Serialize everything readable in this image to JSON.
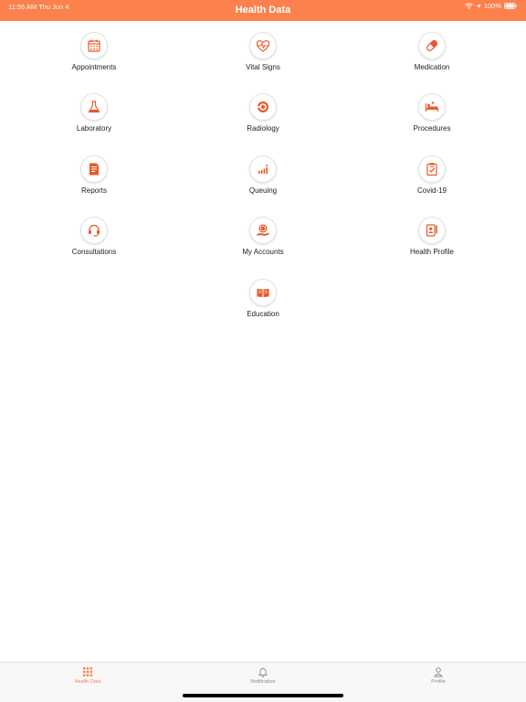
{
  "status": {
    "time": "11:55 AM   Thu Jun 4",
    "battery": "100%"
  },
  "header": {
    "title": "Health Data"
  },
  "colors": {
    "accent": "#fc814c",
    "icon": "#e8592a",
    "tab_inactive": "#8a8a8a"
  },
  "tiles": [
    {
      "label": "Appointments",
      "icon": "calendar-icon"
    },
    {
      "label": "Vital Signs",
      "icon": "heart-pulse-icon"
    },
    {
      "label": "Medication",
      "icon": "pill-icon"
    },
    {
      "label": "Laboratory",
      "icon": "flask-icon"
    },
    {
      "label": "Radiology",
      "icon": "radiology-icon"
    },
    {
      "label": "Procedures",
      "icon": "hospital-bed-icon"
    },
    {
      "label": "Reports",
      "icon": "report-document-icon"
    },
    {
      "label": "Queuing",
      "icon": "queue-icon"
    },
    {
      "label": "Covid-19",
      "icon": "clipboard-check-icon"
    },
    {
      "label": "Consultations",
      "icon": "headset-icon"
    },
    {
      "label": "My Accounts",
      "icon": "coin-hand-icon"
    },
    {
      "label": "Health Profile",
      "icon": "profile-card-icon"
    },
    {
      "label": "Education",
      "icon": "book-icon"
    }
  ],
  "tabs": [
    {
      "label": "Health Data",
      "icon": "grid-icon",
      "active": true
    },
    {
      "label": "Notification",
      "icon": "bell-icon",
      "active": false
    },
    {
      "label": "Profile",
      "icon": "user-icon",
      "active": false
    }
  ]
}
